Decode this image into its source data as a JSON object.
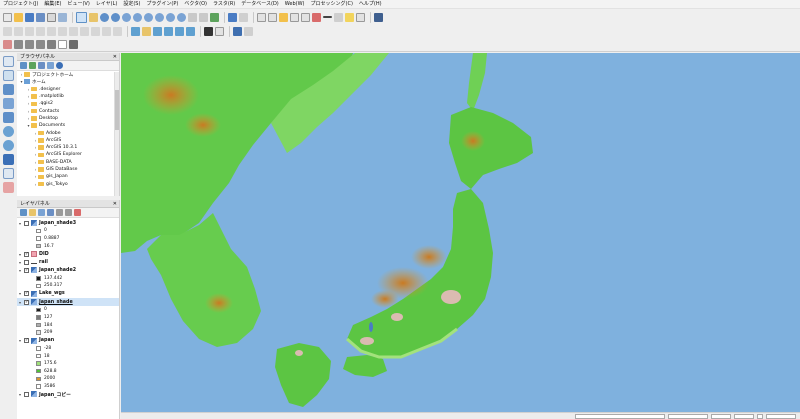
{
  "menubar": {
    "items": [
      "プロジェクト(J)",
      "編集(E)",
      "ビュー(V)",
      "レイヤ(L)",
      "設定(S)",
      "プラグイン(P)",
      "ベクタ(O)",
      "ラスタ(R)",
      "データベース(D)",
      "Web(W)",
      "プロセッシング(C)",
      "ヘルプ(H)"
    ]
  },
  "browser_panel": {
    "title": "ブラウザパネル",
    "items": [
      {
        "label": "プロジェクトホーム",
        "indent": 0,
        "expanded": false,
        "icon": "folder-icon"
      },
      {
        "label": "ホーム",
        "indent": 0,
        "expanded": true,
        "icon": "home-icon"
      },
      {
        "label": ".designer",
        "indent": 1,
        "expanded": false,
        "icon": "folder-icon"
      },
      {
        "label": ".matplotlib",
        "indent": 1,
        "expanded": false,
        "icon": "folder-icon"
      },
      {
        "label": ".qgis2",
        "indent": 1,
        "expanded": false,
        "icon": "folder-icon"
      },
      {
        "label": "Contacts",
        "indent": 1,
        "expanded": false,
        "icon": "folder-icon"
      },
      {
        "label": "Desktop",
        "indent": 1,
        "expanded": false,
        "icon": "folder-icon"
      },
      {
        "label": "Documents",
        "indent": 1,
        "expanded": true,
        "icon": "folder-icon"
      },
      {
        "label": "Adobe",
        "indent": 2,
        "expanded": false,
        "icon": "folder-icon"
      },
      {
        "label": "ArcGIS",
        "indent": 2,
        "expanded": false,
        "icon": "folder-icon"
      },
      {
        "label": "ArcGIS 10.3.1",
        "indent": 2,
        "expanded": false,
        "icon": "folder-icon"
      },
      {
        "label": "ArcGIS Explorer",
        "indent": 2,
        "expanded": false,
        "icon": "folder-icon"
      },
      {
        "label": "BASE-DATA",
        "indent": 2,
        "expanded": false,
        "icon": "folder-icon"
      },
      {
        "label": "GIS DataBase",
        "indent": 2,
        "expanded": false,
        "icon": "folder-icon"
      },
      {
        "label": "gis_Japan",
        "indent": 2,
        "expanded": false,
        "icon": "folder-icon"
      },
      {
        "label": "gis_Tokyo",
        "indent": 2,
        "expanded": false,
        "icon": "folder-icon"
      }
    ]
  },
  "layers_panel": {
    "title": "レイヤパネル",
    "entries": [
      {
        "kind": "layer",
        "label": "Japan_shade3",
        "checked": false,
        "icon": "raster-icon",
        "bold": true
      },
      {
        "kind": "legend",
        "label": "0",
        "color": "#ffffff"
      },
      {
        "kind": "legend",
        "label": "0.8887",
        "color": "#ffffff"
      },
      {
        "kind": "legend",
        "label": "16.7",
        "color": "#c9c9c9"
      },
      {
        "kind": "layer",
        "label": "DID",
        "checked": true,
        "icon": "vector-icon",
        "bold": true
      },
      {
        "kind": "layer",
        "label": "rail",
        "checked": false,
        "icon": "line-icon",
        "bold": true
      },
      {
        "kind": "layer",
        "label": "Japan_shade2",
        "checked": true,
        "icon": "raster-icon",
        "bold": true
      },
      {
        "kind": "legend",
        "label": "137.442",
        "color": "#1a1a1a"
      },
      {
        "kind": "legend",
        "label": "250.317",
        "color": "#ffffff"
      },
      {
        "kind": "layer",
        "label": "Lake_wgs",
        "checked": true,
        "icon": "raster-icon",
        "bold": true
      },
      {
        "kind": "layer",
        "label": "Japan_shade",
        "checked": true,
        "icon": "raster-icon",
        "bold": true,
        "selected": true
      },
      {
        "kind": "legend",
        "label": "0",
        "color": "#1a1a1a"
      },
      {
        "kind": "legend",
        "label": "127",
        "color": "#7a7a7a"
      },
      {
        "kind": "legend",
        "label": "184",
        "color": "#b0b0b0"
      },
      {
        "kind": "legend",
        "label": "209",
        "color": "#e6e6e6"
      },
      {
        "kind": "layer",
        "label": "Japan",
        "checked": true,
        "icon": "raster-icon",
        "bold": true
      },
      {
        "kind": "legend",
        "label": "-28",
        "color": "#ffffff"
      },
      {
        "kind": "legend",
        "label": "18",
        "color": "#ffffff"
      },
      {
        "kind": "legend",
        "label": "175.6",
        "color": "#9fe07a"
      },
      {
        "kind": "legend",
        "label": "628.8",
        "color": "#4fc236"
      },
      {
        "kind": "legend",
        "label": "2000",
        "color": "#d9962e"
      },
      {
        "kind": "legend",
        "label": "3586",
        "color": "#ffffff"
      },
      {
        "kind": "layer",
        "label": "Japan_コピー",
        "checked": false,
        "icon": "raster-icon",
        "bold": true
      }
    ]
  },
  "colors": {
    "sea": "#7fb1de",
    "land_low": "#4fc236",
    "land_mid": "#9fe07a",
    "mountain": "#d9962e",
    "urban": "#f0b8c4"
  }
}
